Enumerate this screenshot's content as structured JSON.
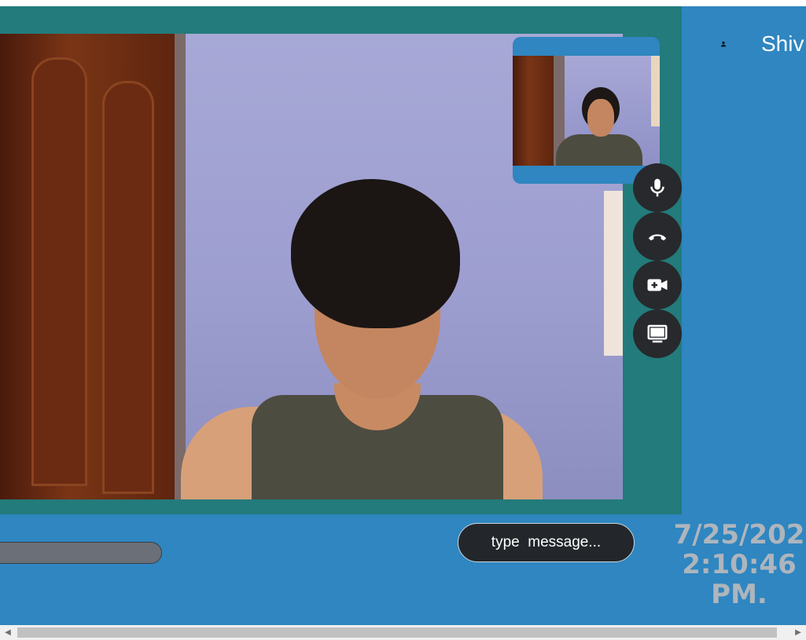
{
  "app": {
    "colors": {
      "background": "#2f86c0",
      "video_panel": "#237b7b",
      "control_button": "#27292d",
      "timestamp_text": "#aeb5bd"
    }
  },
  "remote_video": {
    "description_icon": "video-feed"
  },
  "local_preview": {
    "description_icon": "video-feed"
  },
  "controls": [
    {
      "name": "microphone",
      "icon": "microphone-icon"
    },
    {
      "name": "end-call",
      "icon": "phone-hangup-icon"
    },
    {
      "name": "add-video",
      "icon": "video-add-icon"
    },
    {
      "name": "screen-share",
      "icon": "monitor-icon"
    }
  ],
  "participant": {
    "icon": "user-icon",
    "name": "Shiv"
  },
  "chat": {
    "placeholder": "type  message..."
  },
  "clock": {
    "date": "7/25/202",
    "time": "2:10:46",
    "period": "PM."
  }
}
